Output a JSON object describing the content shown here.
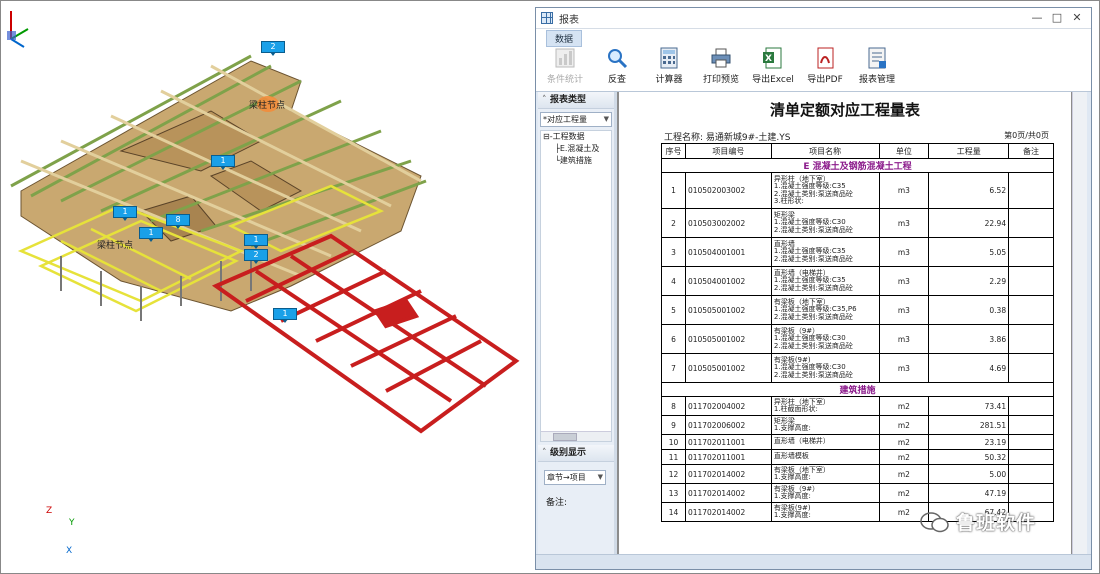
{
  "viewport": {
    "markers": [
      {
        "label": "2"
      },
      {
        "label": "1"
      },
      {
        "label": "1"
      },
      {
        "label": "8"
      },
      {
        "label": "1"
      },
      {
        "label": "1"
      },
      {
        "label": "2"
      },
      {
        "label": "1"
      }
    ],
    "node_labels": [
      "梁柱节点",
      "梁柱节点"
    ],
    "axis": {
      "z": "Z",
      "y": "Y",
      "x": "X"
    }
  },
  "window": {
    "title": "报表",
    "controls": {
      "minimize": "—",
      "maximize": "□",
      "close": "✕"
    },
    "ribbon_tab": "数据",
    "tools": [
      {
        "label": "条件统计",
        "icon": "chart-icon",
        "disabled": true
      },
      {
        "label": "反查",
        "icon": "magnifier-icon",
        "disabled": false
      },
      {
        "label": "计算器",
        "icon": "calculator-icon",
        "disabled": false
      },
      {
        "label": "打印预览",
        "icon": "printer-icon",
        "disabled": false
      },
      {
        "label": "导出Excel",
        "icon": "excel-icon",
        "disabled": false
      },
      {
        "label": "导出PDF",
        "icon": "pdf-icon",
        "disabled": false
      },
      {
        "label": "报表管理",
        "icon": "report-manage-icon",
        "disabled": false
      }
    ]
  },
  "side": {
    "report_type_title": "报表类型",
    "report_type_value": "*对应工程量",
    "tree": {
      "root": "工程数据",
      "children": [
        "E.混凝土及",
        "建筑措施"
      ]
    },
    "level_title": "级别显示",
    "level_value": "章节→项目",
    "note_label": "备注:"
  },
  "report": {
    "title": "清单定额对应工程量表",
    "project": "工程名称: 易通新城9#-土建.YS",
    "page": "第0页/共0页",
    "headers": [
      "序号",
      "项目编号",
      "项目名称",
      "单位",
      "工程量",
      "备注"
    ],
    "sections": [
      {
        "title": "E  混凝土及钢筋混凝土工程",
        "rows": [
          {
            "no": "1",
            "code": "010502003002",
            "name": [
              "异形柱（地下室）",
              "1.混凝土强度等级:C35",
              "2.混凝土类别:泵送商品砼",
              "3.柱形状:"
            ],
            "unit": "m3",
            "qty": "6.52"
          },
          {
            "no": "2",
            "code": "010503002002",
            "name": [
              "矩形梁",
              "1.混凝土强度等级:C30",
              "2.混凝土类别:泵送商品砼"
            ],
            "unit": "m3",
            "qty": "22.94"
          },
          {
            "no": "3",
            "code": "010504001001",
            "name": [
              "直形墙",
              "1.混凝土强度等级:C35",
              "2.混凝土类别:泵送商品砼"
            ],
            "unit": "m3",
            "qty": "5.05"
          },
          {
            "no": "4",
            "code": "010504001002",
            "name": [
              "直形墙（电梯井）",
              "1.混凝土强度等级:C35",
              "2.混凝土类别:泵送商品砼"
            ],
            "unit": "m3",
            "qty": "2.29"
          },
          {
            "no": "5",
            "code": "010505001002",
            "name": [
              "有梁板（地下室）",
              "1.混凝土强度等级:C35,P6",
              "2.混凝土类别:泵送商品砼"
            ],
            "unit": "m3",
            "qty": "0.38"
          },
          {
            "no": "6",
            "code": "010505001002",
            "name": [
              "有梁板（9#）",
              "1.混凝土强度等级:C30",
              "2.混凝土类别:泵送商品砼"
            ],
            "unit": "m3",
            "qty": "3.86"
          },
          {
            "no": "7",
            "code": "010505001002",
            "name": [
              "有梁板(9#)",
              "1.混凝土强度等级:C30",
              "2.混凝土类别:泵送商品砼"
            ],
            "unit": "m3",
            "qty": "4.69"
          }
        ]
      },
      {
        "title": "建筑措施",
        "rows": [
          {
            "no": "8",
            "code": "011702004002",
            "name": [
              "异形柱（地下室）",
              "1.柱截面形状:"
            ],
            "unit": "m2",
            "qty": "73.41"
          },
          {
            "no": "9",
            "code": "011702006002",
            "name": [
              "矩形梁",
              "1.支撑高度:"
            ],
            "unit": "m2",
            "qty": "281.51"
          },
          {
            "no": "10",
            "code": "011702011001",
            "name": [
              "直形墙（电梯井）"
            ],
            "unit": "m2",
            "qty": "23.19"
          },
          {
            "no": "11",
            "code": "011702011001",
            "name": [
              "直形墙模板"
            ],
            "unit": "m2",
            "qty": "50.32"
          },
          {
            "no": "12",
            "code": "011702014002",
            "name": [
              "有梁板（地下室）",
              "1.支撑高度:"
            ],
            "unit": "m2",
            "qty": "5.00"
          },
          {
            "no": "13",
            "code": "011702014002",
            "name": [
              "有梁板（9#）",
              "1.支撑高度:"
            ],
            "unit": "m2",
            "qty": "47.19"
          },
          {
            "no": "14",
            "code": "011702014002",
            "name": [
              "有梁板(9#)",
              "1.支撑高度:"
            ],
            "unit": "m2",
            "qty": "67.42"
          }
        ]
      }
    ]
  },
  "watermark": "鲁班软件",
  "colors": {
    "beam_tan": "#c9a870",
    "beam_green": "#7fa24a",
    "beam_yellow": "#e6e23a",
    "beam_red": "#c81e1e",
    "marker": "#1aa0e8",
    "section_purple": "#8b1a8b"
  }
}
